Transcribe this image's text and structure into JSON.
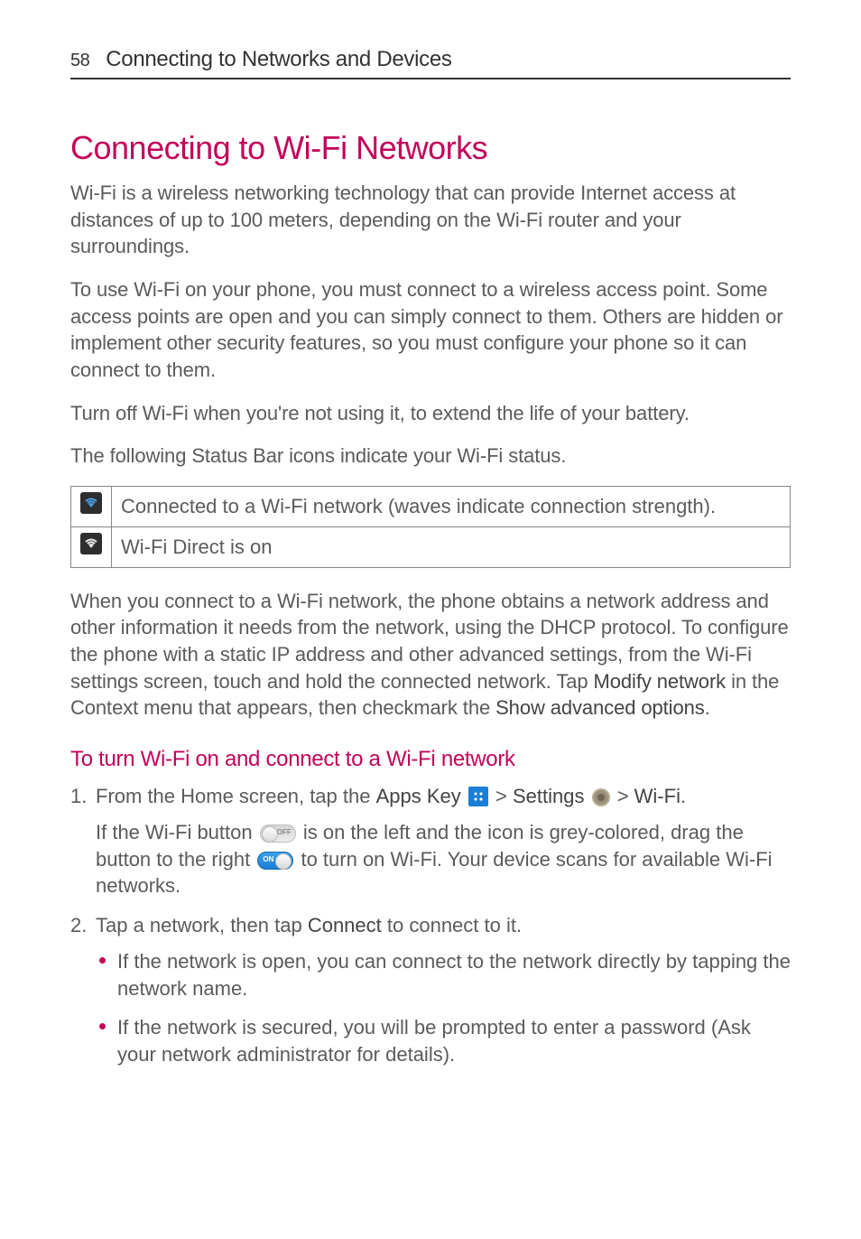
{
  "header": {
    "page_number": "58",
    "breadcrumb": "Connecting to Networks and Devices"
  },
  "title": "Connecting to Wi-Fi Networks",
  "paragraphs": {
    "p1": "Wi-Fi is a wireless networking technology that can provide Internet access at distances of up to 100 meters, depending on the Wi-Fi router and your surroundings.",
    "p2": "To use Wi-Fi on your phone, you must connect to a wireless access point. Some access points are open and you can simply connect to them. Others are hidden or implement other security features, so you must configure your phone so it can connect to them.",
    "p3": "Turn off Wi-Fi when you're not using it, to extend the life of your battery.",
    "p4": "The following Status Bar icons indicate your Wi-Fi status."
  },
  "icon_table": {
    "row1": "Connected to a Wi-Fi network (waves indicate connection strength).",
    "row2": " Wi-Fi Direct is on"
  },
  "paragraphs2": {
    "p5a": "When you connect to a Wi-Fi network, the phone obtains a network address and other information it needs from the network, using the DHCP protocol. To configure the phone with a static IP address and other advanced settings, from the Wi-Fi settings screen, touch and hold the connected network. Tap ",
    "p5_bold1": "Modify network",
    "p5b": " in the Context menu that appears, then checkmark the ",
    "p5_bold2": "Show advanced options",
    "p5c": "."
  },
  "section2_heading": "To turn Wi-Fi on and connect to a Wi-Fi network",
  "steps": {
    "s1_a": "From the Home screen, tap the ",
    "s1_apps": "Apps Key",
    "s1_b": " > ",
    "s1_settings": "Settings",
    "s1_c": " > ",
    "s1_wifi": "Wi-Fi",
    "s1_d": ".",
    "s1_sub_a": "If the Wi-Fi button ",
    "s1_sub_b": " is on the left and the icon is grey-colored, drag the button to the right ",
    "s1_sub_c": " to turn on Wi-Fi. Your device scans for available Wi-Fi networks.",
    "s2_a": "Tap a network, then tap ",
    "s2_connect": "Connect",
    "s2_b": " to connect to it.",
    "s2_bullet1": "If the network is open, you can connect to the network directly by tapping the network name.",
    "s2_bullet2": "If the network is secured, you will be prompted to enter a password (Ask your network administrator for details)."
  }
}
